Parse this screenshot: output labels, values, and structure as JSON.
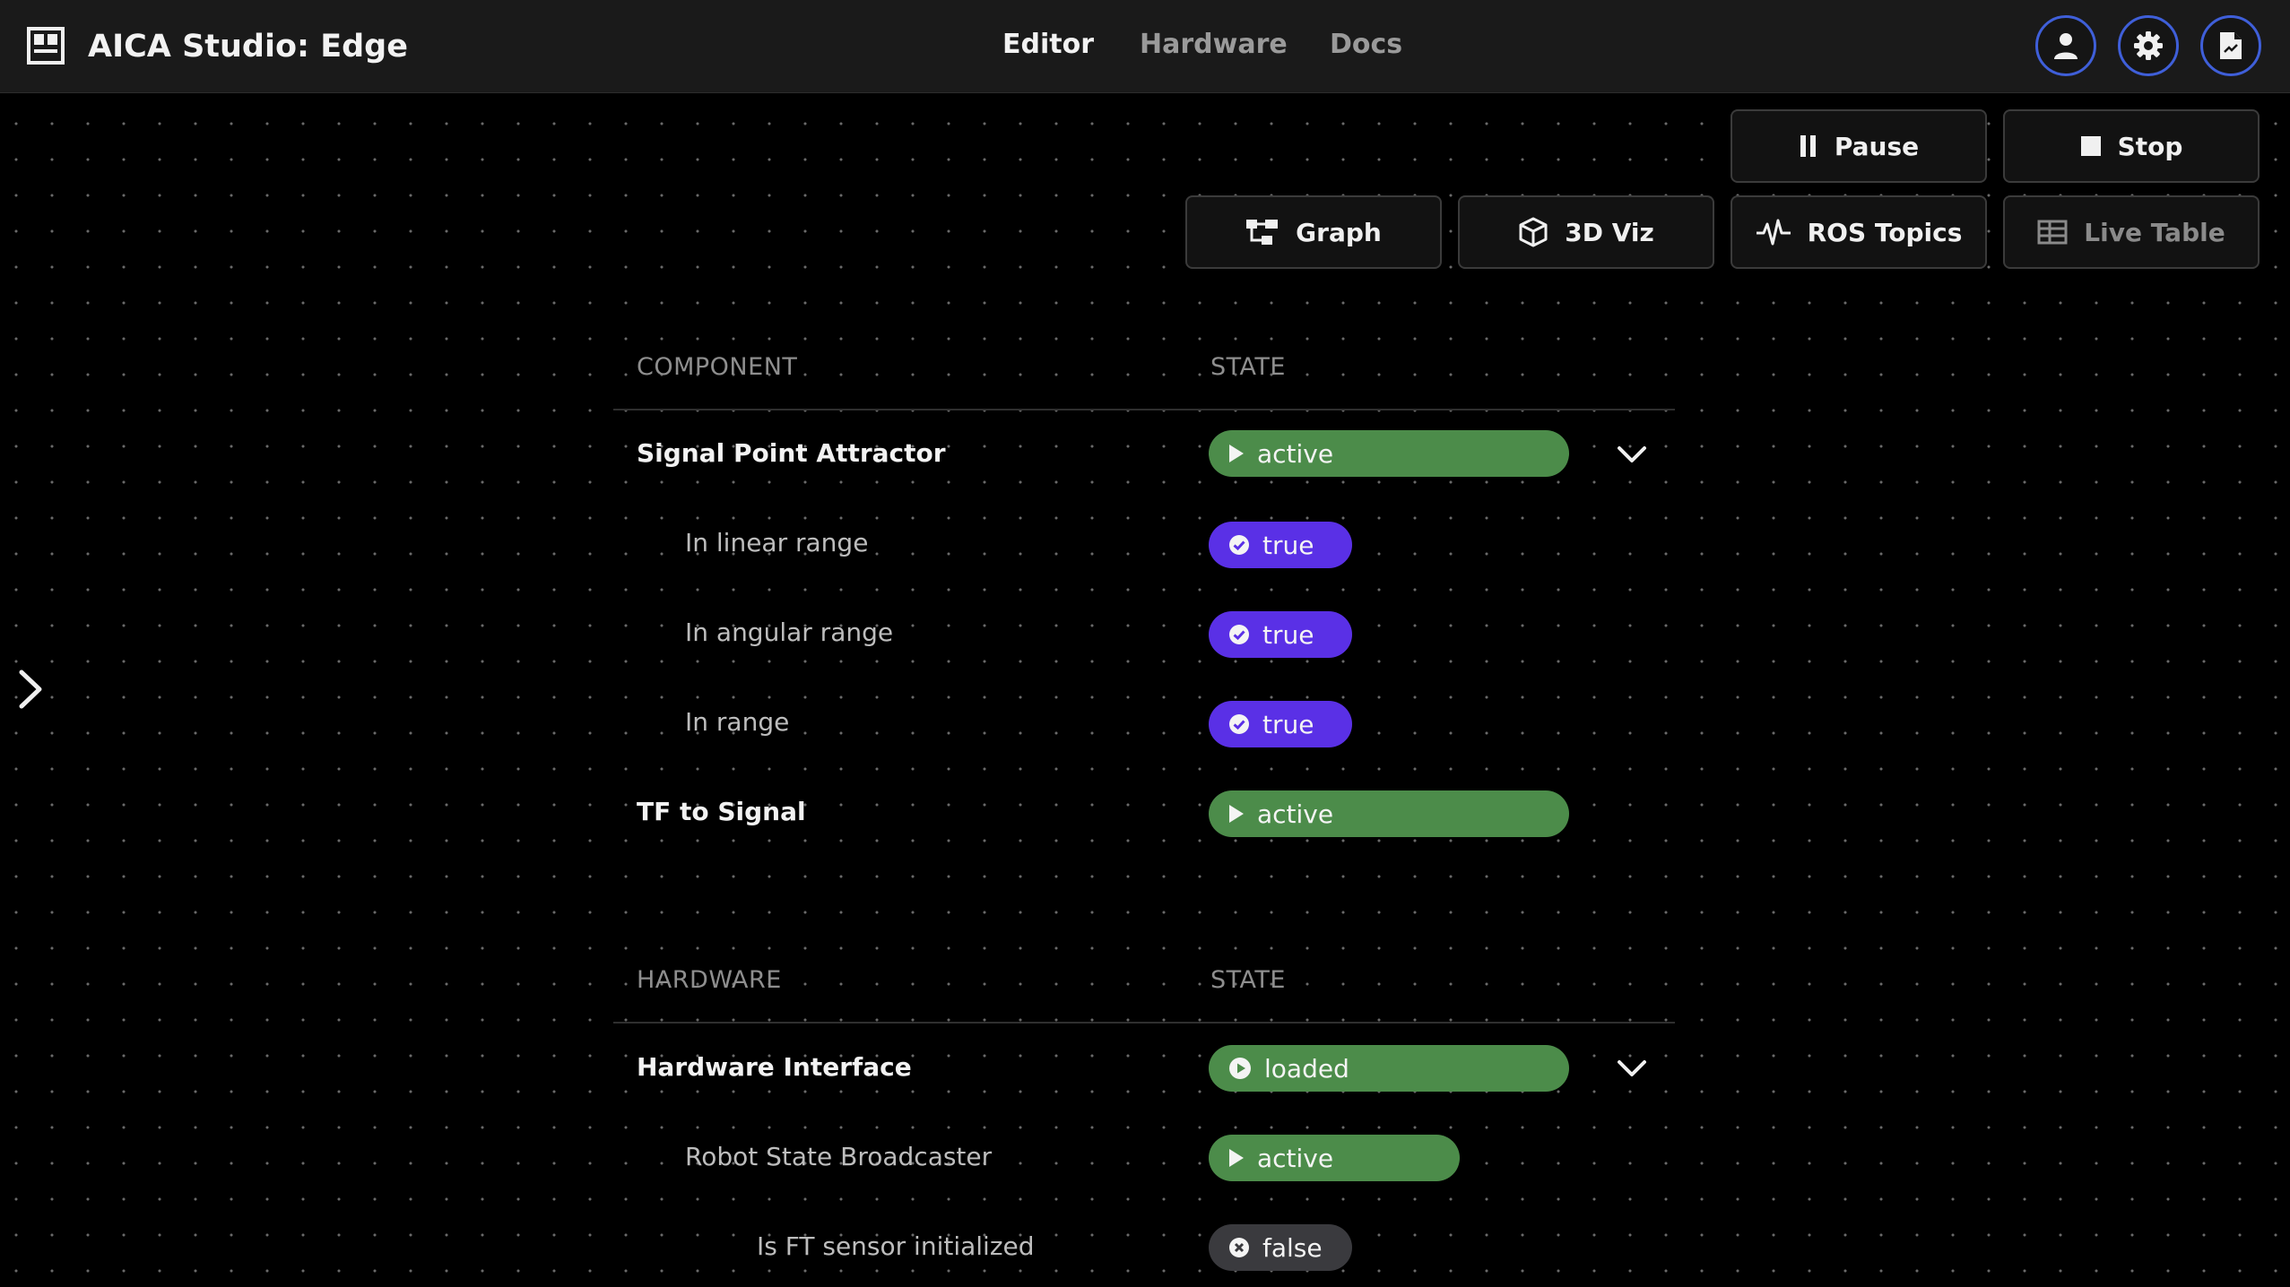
{
  "app": {
    "title": "AICA Studio: Edge"
  },
  "nav": {
    "editor": "Editor",
    "hardware": "Hardware",
    "docs": "Docs"
  },
  "header_icons": [
    "user-icon",
    "gear-icon",
    "document-icon"
  ],
  "controls": {
    "pause": "Pause",
    "stop": "Stop"
  },
  "views": {
    "graph": "Graph",
    "viz3d": "3D Viz",
    "ros_topics": "ROS Topics",
    "live_table": "Live Table"
  },
  "components_table": {
    "col_name": "COMPONENT",
    "col_state": "STATE",
    "rows": [
      {
        "label": "Signal Point Attractor",
        "state": "active"
      },
      {
        "label": "In linear range",
        "state": "true"
      },
      {
        "label": "In angular range",
        "state": "true"
      },
      {
        "label": "In range",
        "state": "true"
      },
      {
        "label": "TF to Signal",
        "state": "active"
      }
    ]
  },
  "hardware_table": {
    "col_name": "HARDWARE",
    "col_state": "STATE",
    "rows": [
      {
        "label": "Hardware Interface",
        "state": "loaded"
      },
      {
        "label": "Robot State Broadcaster",
        "state": "active"
      },
      {
        "label": "Is FT sensor initialized",
        "state": "false"
      }
    ]
  },
  "colors": {
    "active_green": "#4c8c4a",
    "true_purple": "#5a30e6",
    "false_gray": "#3a3a3e",
    "accent_blue": "#3f5fd9",
    "background": "#000000"
  }
}
